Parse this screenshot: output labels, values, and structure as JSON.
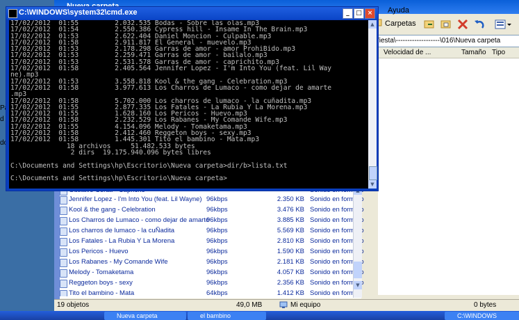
{
  "explorer": {
    "title": "Nueva carpeta",
    "menu_ayuda": "Ayuda",
    "toolbar_folders": "Carpetas",
    "address": "fiesta\\-------------------\\016\\Nueva carpeta",
    "columns": {
      "velocidad": "Velocidad de ...",
      "tamano": "Tamaño",
      "tipo": "Tipo"
    },
    "rows": [
      {
        "name": "Gustavo Cerati - Capricho",
        "bitrate": "",
        "size": "",
        "type": "Sonido en formato"
      },
      {
        "name": "Jennifer Lopez - I'm Into You (feat. Lil Wayne)",
        "bitrate": "96kbps",
        "size": "2.350 KB",
        "type": "Sonido en formato"
      },
      {
        "name": "Kool & the gang - Celebration",
        "bitrate": "96kbps",
        "size": "3.476 KB",
        "type": "Sonido en formato"
      },
      {
        "name": "Los Charros de Lumaco - como dejar de amarte",
        "bitrate": "96kbps",
        "size": "3.885 KB",
        "type": "Sonido en formato"
      },
      {
        "name": "Los charros de lumaco - la cuÑadita",
        "bitrate": "96kbps",
        "size": "5.569 KB",
        "type": "Sonido en formato"
      },
      {
        "name": "Los Fatales - La Rubia Y La Morena",
        "bitrate": "96kbps",
        "size": "2.810 KB",
        "type": "Sonido en formato"
      },
      {
        "name": "Los Pericos - Huevo",
        "bitrate": "96kbps",
        "size": "1.590 KB",
        "type": "Sonido en formato"
      },
      {
        "name": "Los Rabanes - My Comande Wife",
        "bitrate": "96kbps",
        "size": "2.181 KB",
        "type": "Sonido en formato"
      },
      {
        "name": "Melody - Tomaketama",
        "bitrate": "96kbps",
        "size": "4.057 KB",
        "type": "Sonido en formato"
      },
      {
        "name": "Reggeton boys - sexy",
        "bitrate": "96kbps",
        "size": "2.356 KB",
        "type": "Sonido en formato"
      },
      {
        "name": "Tito el bambino - Mata",
        "bitrate": "64kbps",
        "size": "1.412 KB",
        "type": "Sonido en formato"
      }
    ],
    "status_objects": "19 objetos",
    "status_size": "49,0 MB",
    "status_location": "Mi equipo",
    "status_right": "0 bytes",
    "side_labels": [
      "Pa",
      "d",
      "do"
    ]
  },
  "cmd": {
    "title": "C:\\WINDOWS\\system32\\cmd.exe",
    "output": "17/02/2012  01:55         2.032.535 Bodas - Sobre las olas.mp3\n17/02/2012  01:54         2.550.386 Cypress hill - Insame In The Brain.mp3\n17/02/2012  01:53         2.622.404 Daniel Moncion - Culpable.mp3\n17/02/2012  01:58         2.911.817 El General - muevelo.mp3\n17/02/2012  01:53         2.178.298 Garras de amor - amor ProhiBido.mp3\n17/02/2012  01:53         2.259.471 Garras de amor - bailalo.mp3\n17/02/2012  01:53         2.531.578 Garras de amor - caprichito.mp3\n17/02/2012  01:58         2.405.564 Jennifer Lopez - I'm Into You (feat. Lil Way\nne).mp3\n17/02/2012  01:53         3.558.818 Kool & the gang - Celebration.mp3\n17/02/2012  01:58         3.977.613 Los Charros de Lumaco - como dejar de amarte\n.mp3\n17/02/2012  01:58         5.702.000 Los charros de lumaco - la cuñadita.mp3\n17/02/2012  01:55         2.877.335 Los Fatales - La Rubia Y La Morena.mp3\n17/02/2012  01:55         1.628.160 Los Pericos - Huevo.mp3\n17/02/2012  01:58         2.232.529 Los Rabanes - My Comande Wife.mp3\n17/02/2012  01:55         4.154.096 Melody - Tomaketama.mp3\n17/02/2012  01:58         2.412.460 Reggeton boys - sexy.mp3\n17/02/2012  01:58         1.445.301 Tito el bambino - Mata.mp3\n              18 archivos     51.482.533 bytes\n               2 dirs  19.175.940.096 bytes libres\n\nC:\\Documents and Settings\\hp\\Escritorio\\Nueva carpeta>dir/b>lista.txt\n\nC:\\Documents and Settings\\hp\\Escritorio\\Nueva carpeta>",
    "btn_min": "_",
    "btn_max": "□",
    "btn_close": "×"
  },
  "taskbar": {
    "items": [
      "",
      "Nueva carpeta",
      "el bambino",
      "",
      "",
      "C:\\WINDOWS"
    ]
  }
}
